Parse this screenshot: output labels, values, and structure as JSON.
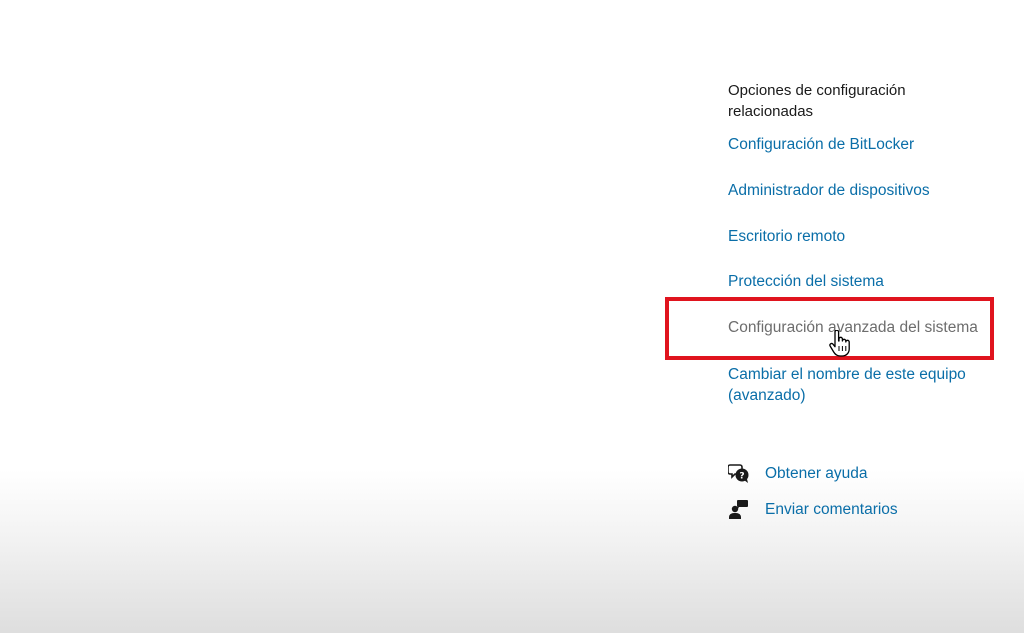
{
  "related_settings": {
    "heading": "Opciones de configuración relacionadas",
    "links": {
      "bitlocker": "Configuración de BitLocker",
      "device_manager": "Administrador de dispositivos",
      "remote_desktop": "Escritorio remoto",
      "system_protection": "Protección del sistema",
      "advanced_system": "Configuración avanzada del sistema",
      "rename_pc": "Cambiar el nombre de este equipo (avanzado)"
    }
  },
  "support": {
    "help": {
      "label": "Obtener ayuda",
      "icon": "help-chat-icon"
    },
    "feedback": {
      "label": "Enviar comentarios",
      "icon": "feedback-person-icon"
    }
  },
  "colors": {
    "link": "#0a6ea8",
    "hovered_link": "#6d6d6d",
    "highlight": "#e0141e",
    "text": "#1a1a1a"
  }
}
